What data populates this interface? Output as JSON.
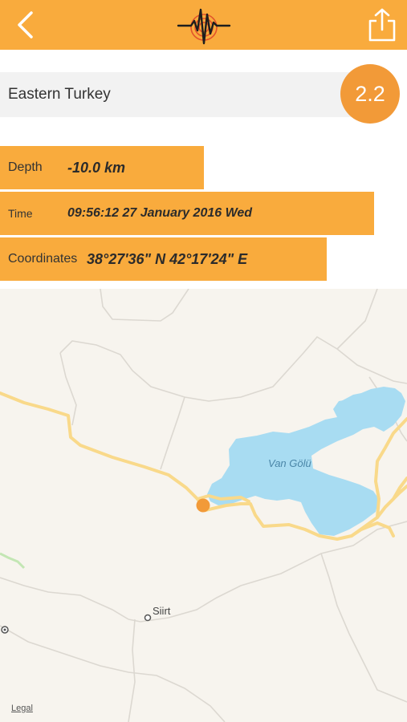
{
  "navbar": {
    "back_icon": "chevron-left-icon",
    "logo_icon": "seismograph-logo-icon",
    "share_icon": "share-icon",
    "color": "#f9ab3d"
  },
  "quake": {
    "region": "Eastern Turkey",
    "magnitude": "2.2",
    "magnitude_color": "#f29a38"
  },
  "details": {
    "depth_label": "Depth",
    "depth_value": "-10.0 km",
    "time_label": "Time",
    "time_value": "09:56:12 27 January 2016 Wed",
    "coords_label": "Coordinates",
    "coords_value": "38°27'36\" N 42°17'24\" E"
  },
  "map": {
    "lake_label": "Van Gölü",
    "city_label": "Siirt",
    "legal_label": "Legal",
    "lake_color": "#a8dcf2",
    "road_color": "#f9d98a",
    "marker_color": "#f29a38"
  }
}
